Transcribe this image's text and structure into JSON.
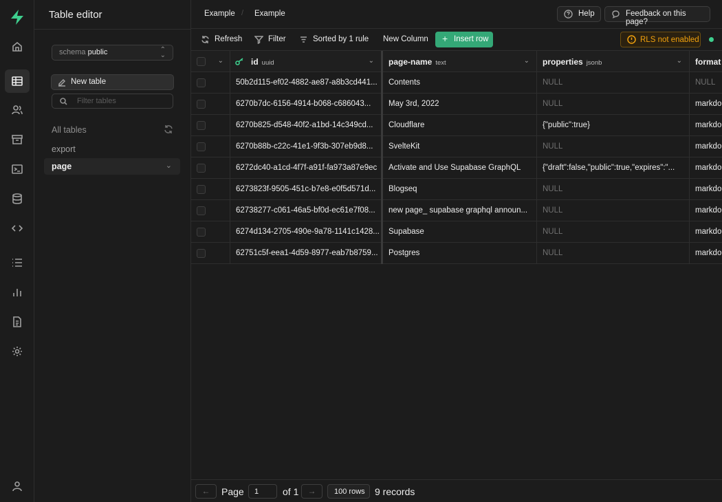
{
  "app": {
    "title": "Table editor"
  },
  "breadcrumb": [
    "Example",
    "Example"
  ],
  "header": {
    "help_label": "Help",
    "feedback_label": "Feedback on this page?"
  },
  "sidebar": {
    "schema_prefix": "schema",
    "schema_value": "public",
    "new_table_label": "New table",
    "filter_placeholder": "Filter tables",
    "all_tables_label": "All tables",
    "tables": [
      {
        "name": "export",
        "active": false
      },
      {
        "name": "page",
        "active": true
      }
    ]
  },
  "rail_icons": [
    "home-icon",
    "table-editor-icon",
    "users-icon",
    "storage-icon",
    "sql-editor-icon",
    "database-icon",
    "api-icon",
    "logs-icon",
    "reports-icon",
    "docs-icon",
    "settings-icon",
    "account-icon"
  ],
  "toolbar": {
    "refresh_label": "Refresh",
    "filter_label": "Filter",
    "sort_label": "Sorted by 1 rule",
    "new_column_label": "New Column",
    "insert_row_label": "Insert row",
    "rls_label": "RLS not enabled",
    "accent_color": "#3ecf8e",
    "warning_color": "#f1a10d"
  },
  "grid": {
    "columns": [
      {
        "name": "id",
        "type": "uuid",
        "primary_key": true
      },
      {
        "name": "page-name",
        "type": "text"
      },
      {
        "name": "properties",
        "type": "jsonb"
      },
      {
        "name": "format",
        "type": ""
      }
    ],
    "rows": [
      [
        "50b2d115-ef02-4882-ae87-a8b3cd441...",
        "Contents",
        "NULL",
        "NULL"
      ],
      [
        "6270b7dc-6156-4914-b068-c686043...",
        "May 3rd, 2022",
        "NULL",
        "markdo"
      ],
      [
        "6270b825-d548-40f2-a1bd-14c349cd...",
        "Cloudflare",
        "{\"public\":true}",
        "markdo"
      ],
      [
        "6270b88b-c22c-41e1-9f3b-307eb9d8...",
        "SvelteKit",
        "NULL",
        "markdo"
      ],
      [
        "6272dc40-a1cd-4f7f-a91f-fa973a87e9ec",
        "Activate and Use Supabase GraphQL",
        "{\"draft\":false,\"public\":true,\"expires\":\"...",
        "markdo"
      ],
      [
        "6273823f-9505-451c-b7e8-e0f5d571d...",
        "Blogseq",
        "NULL",
        "markdo"
      ],
      [
        "62738277-c061-46a5-bf0d-ec61e7f08...",
        "new page_ supabase graphql announ...",
        "NULL",
        "markdo"
      ],
      [
        "6274d134-2705-490e-9a78-1141c1428...",
        "Supabase",
        "NULL",
        "markdo"
      ],
      [
        "62751c5f-eea1-4d59-8977-eab7b8759...",
        "Postgres",
        "NULL",
        "markdo"
      ]
    ]
  },
  "footer": {
    "page_label": "Page",
    "page_value": "1",
    "of_label": "of 1",
    "rows_label": "100 rows",
    "records_label": "9 records"
  }
}
